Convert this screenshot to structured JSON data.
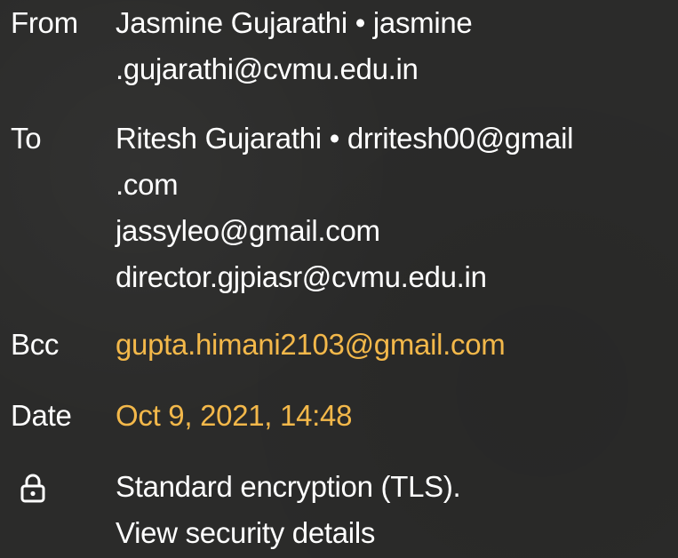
{
  "from": {
    "label": "From",
    "name": "Jasmine Gujarathi",
    "separator": "•",
    "email_part1": "jasmine",
    "email_part2": ".gujarathi@cvmu.edu.in"
  },
  "to": {
    "label": "To",
    "name": "Ritesh Gujarathi",
    "separator": "•",
    "email_part1": "drritesh00@gmail",
    "email_part2": ".com",
    "additional": [
      "jassyleo@gmail.com",
      "director.gjpiasr@cvmu.edu.in"
    ]
  },
  "bcc": {
    "label": "Bcc",
    "email": "gupta.himani2103@gmail.com"
  },
  "date": {
    "label": "Date",
    "value": "Oct 9, 2021, 14:48"
  },
  "security": {
    "icon": "lock-icon",
    "text": "Standard encryption (TLS).",
    "link": "View security details"
  },
  "colors": {
    "background": "#2b2b2a",
    "text": "#ffffff",
    "accent": "#f3b84a"
  }
}
